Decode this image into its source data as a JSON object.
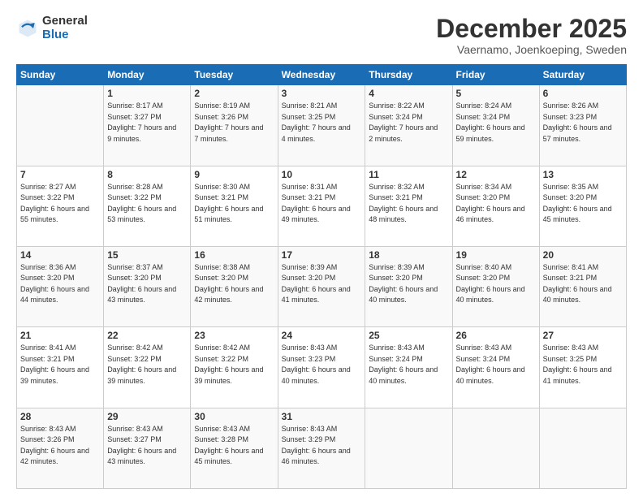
{
  "logo": {
    "general": "General",
    "blue": "Blue"
  },
  "header": {
    "month": "December 2025",
    "location": "Vaernamo, Joenkoeping, Sweden"
  },
  "weekdays": [
    "Sunday",
    "Monday",
    "Tuesday",
    "Wednesday",
    "Thursday",
    "Friday",
    "Saturday"
  ],
  "weeks": [
    [
      {
        "day": "",
        "sunrise": "",
        "sunset": "",
        "daylight": ""
      },
      {
        "day": "1",
        "sunrise": "Sunrise: 8:17 AM",
        "sunset": "Sunset: 3:27 PM",
        "daylight": "Daylight: 7 hours and 9 minutes."
      },
      {
        "day": "2",
        "sunrise": "Sunrise: 8:19 AM",
        "sunset": "Sunset: 3:26 PM",
        "daylight": "Daylight: 7 hours and 7 minutes."
      },
      {
        "day": "3",
        "sunrise": "Sunrise: 8:21 AM",
        "sunset": "Sunset: 3:25 PM",
        "daylight": "Daylight: 7 hours and 4 minutes."
      },
      {
        "day": "4",
        "sunrise": "Sunrise: 8:22 AM",
        "sunset": "Sunset: 3:24 PM",
        "daylight": "Daylight: 7 hours and 2 minutes."
      },
      {
        "day": "5",
        "sunrise": "Sunrise: 8:24 AM",
        "sunset": "Sunset: 3:24 PM",
        "daylight": "Daylight: 6 hours and 59 minutes."
      },
      {
        "day": "6",
        "sunrise": "Sunrise: 8:26 AM",
        "sunset": "Sunset: 3:23 PM",
        "daylight": "Daylight: 6 hours and 57 minutes."
      }
    ],
    [
      {
        "day": "7",
        "sunrise": "Sunrise: 8:27 AM",
        "sunset": "Sunset: 3:22 PM",
        "daylight": "Daylight: 6 hours and 55 minutes."
      },
      {
        "day": "8",
        "sunrise": "Sunrise: 8:28 AM",
        "sunset": "Sunset: 3:22 PM",
        "daylight": "Daylight: 6 hours and 53 minutes."
      },
      {
        "day": "9",
        "sunrise": "Sunrise: 8:30 AM",
        "sunset": "Sunset: 3:21 PM",
        "daylight": "Daylight: 6 hours and 51 minutes."
      },
      {
        "day": "10",
        "sunrise": "Sunrise: 8:31 AM",
        "sunset": "Sunset: 3:21 PM",
        "daylight": "Daylight: 6 hours and 49 minutes."
      },
      {
        "day": "11",
        "sunrise": "Sunrise: 8:32 AM",
        "sunset": "Sunset: 3:21 PM",
        "daylight": "Daylight: 6 hours and 48 minutes."
      },
      {
        "day": "12",
        "sunrise": "Sunrise: 8:34 AM",
        "sunset": "Sunset: 3:20 PM",
        "daylight": "Daylight: 6 hours and 46 minutes."
      },
      {
        "day": "13",
        "sunrise": "Sunrise: 8:35 AM",
        "sunset": "Sunset: 3:20 PM",
        "daylight": "Daylight: 6 hours and 45 minutes."
      }
    ],
    [
      {
        "day": "14",
        "sunrise": "Sunrise: 8:36 AM",
        "sunset": "Sunset: 3:20 PM",
        "daylight": "Daylight: 6 hours and 44 minutes."
      },
      {
        "day": "15",
        "sunrise": "Sunrise: 8:37 AM",
        "sunset": "Sunset: 3:20 PM",
        "daylight": "Daylight: 6 hours and 43 minutes."
      },
      {
        "day": "16",
        "sunrise": "Sunrise: 8:38 AM",
        "sunset": "Sunset: 3:20 PM",
        "daylight": "Daylight: 6 hours and 42 minutes."
      },
      {
        "day": "17",
        "sunrise": "Sunrise: 8:39 AM",
        "sunset": "Sunset: 3:20 PM",
        "daylight": "Daylight: 6 hours and 41 minutes."
      },
      {
        "day": "18",
        "sunrise": "Sunrise: 8:39 AM",
        "sunset": "Sunset: 3:20 PM",
        "daylight": "Daylight: 6 hours and 40 minutes."
      },
      {
        "day": "19",
        "sunrise": "Sunrise: 8:40 AM",
        "sunset": "Sunset: 3:20 PM",
        "daylight": "Daylight: 6 hours and 40 minutes."
      },
      {
        "day": "20",
        "sunrise": "Sunrise: 8:41 AM",
        "sunset": "Sunset: 3:21 PM",
        "daylight": "Daylight: 6 hours and 40 minutes."
      }
    ],
    [
      {
        "day": "21",
        "sunrise": "Sunrise: 8:41 AM",
        "sunset": "Sunset: 3:21 PM",
        "daylight": "Daylight: 6 hours and 39 minutes."
      },
      {
        "day": "22",
        "sunrise": "Sunrise: 8:42 AM",
        "sunset": "Sunset: 3:22 PM",
        "daylight": "Daylight: 6 hours and 39 minutes."
      },
      {
        "day": "23",
        "sunrise": "Sunrise: 8:42 AM",
        "sunset": "Sunset: 3:22 PM",
        "daylight": "Daylight: 6 hours and 39 minutes."
      },
      {
        "day": "24",
        "sunrise": "Sunrise: 8:43 AM",
        "sunset": "Sunset: 3:23 PM",
        "daylight": "Daylight: 6 hours and 40 minutes."
      },
      {
        "day": "25",
        "sunrise": "Sunrise: 8:43 AM",
        "sunset": "Sunset: 3:24 PM",
        "daylight": "Daylight: 6 hours and 40 minutes."
      },
      {
        "day": "26",
        "sunrise": "Sunrise: 8:43 AM",
        "sunset": "Sunset: 3:24 PM",
        "daylight": "Daylight: 6 hours and 40 minutes."
      },
      {
        "day": "27",
        "sunrise": "Sunrise: 8:43 AM",
        "sunset": "Sunset: 3:25 PM",
        "daylight": "Daylight: 6 hours and 41 minutes."
      }
    ],
    [
      {
        "day": "28",
        "sunrise": "Sunrise: 8:43 AM",
        "sunset": "Sunset: 3:26 PM",
        "daylight": "Daylight: 6 hours and 42 minutes."
      },
      {
        "day": "29",
        "sunrise": "Sunrise: 8:43 AM",
        "sunset": "Sunset: 3:27 PM",
        "daylight": "Daylight: 6 hours and 43 minutes."
      },
      {
        "day": "30",
        "sunrise": "Sunrise: 8:43 AM",
        "sunset": "Sunset: 3:28 PM",
        "daylight": "Daylight: 6 hours and 45 minutes."
      },
      {
        "day": "31",
        "sunrise": "Sunrise: 8:43 AM",
        "sunset": "Sunset: 3:29 PM",
        "daylight": "Daylight: 6 hours and 46 minutes."
      },
      {
        "day": "",
        "sunrise": "",
        "sunset": "",
        "daylight": ""
      },
      {
        "day": "",
        "sunrise": "",
        "sunset": "",
        "daylight": ""
      },
      {
        "day": "",
        "sunrise": "",
        "sunset": "",
        "daylight": ""
      }
    ]
  ]
}
